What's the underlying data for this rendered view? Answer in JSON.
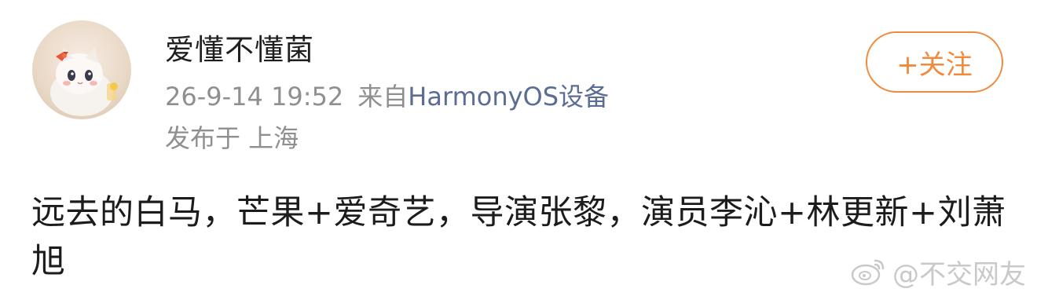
{
  "user": {
    "name": "爱懂不懂菌"
  },
  "post_meta": {
    "timestamp": "26-9-14 19:52",
    "from_label": "来自",
    "device": "HarmonyOS设备",
    "location": "发布于 上海"
  },
  "follow_button": {
    "icon": "plus-icon",
    "label": "+关注"
  },
  "content": {
    "text": "远去的白马，芒果+爱奇艺，导演张黎，演员李沁+林更新+刘萧旭"
  },
  "watermark": {
    "icon": "weibo-logo-icon",
    "text": "@不交网友"
  },
  "colors": {
    "accent": "#f08a3c",
    "device_link": "#5b6d93",
    "meta_text": "#8f8f8f"
  }
}
